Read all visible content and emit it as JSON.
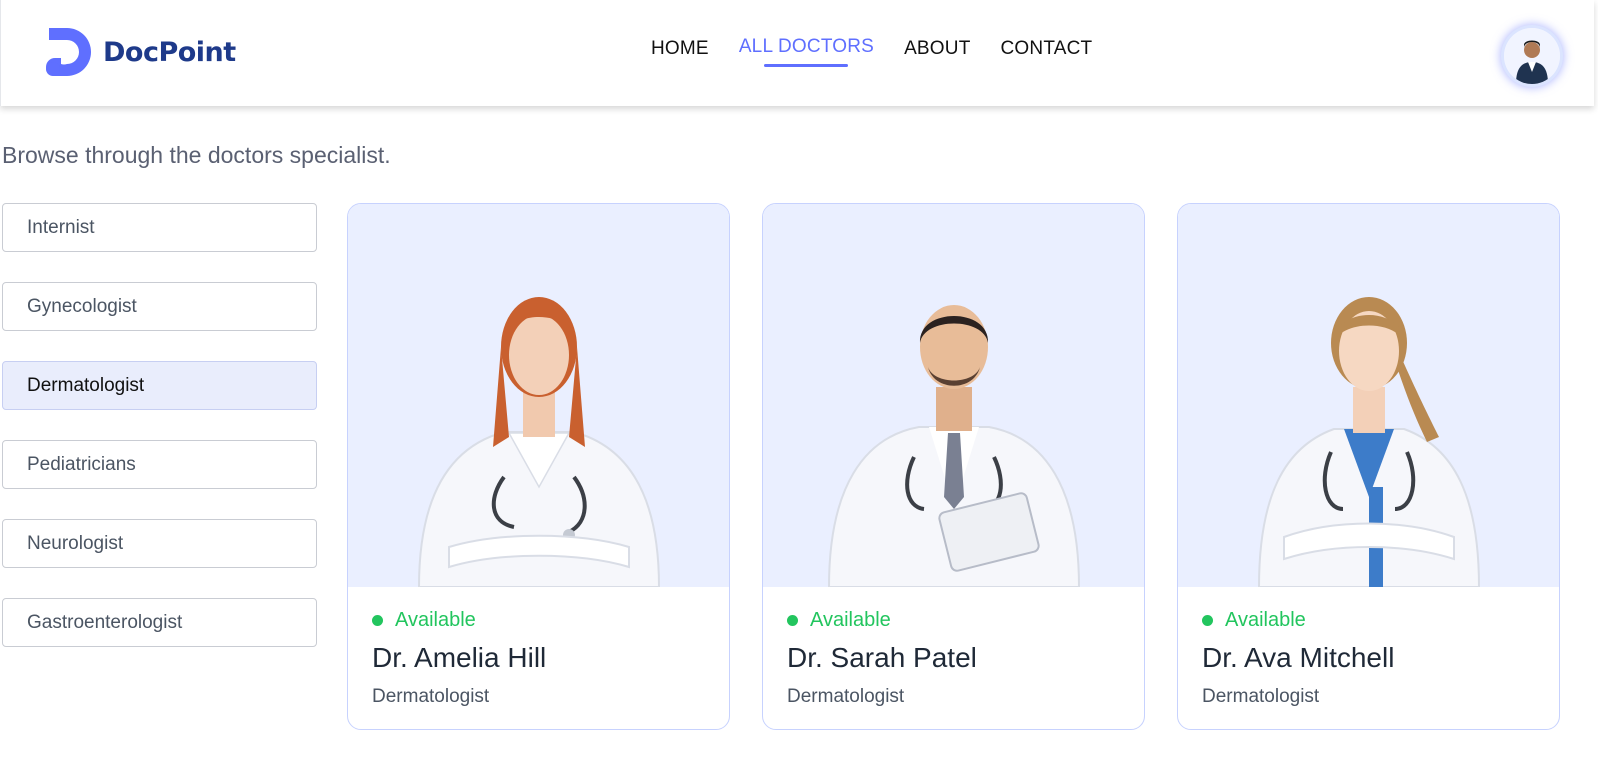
{
  "brand": {
    "name": "DocPoint",
    "color": "#1e3a8a",
    "accent": "#5f6fff"
  },
  "nav": {
    "items": [
      {
        "label": "HOME",
        "active": false
      },
      {
        "label": "ALL DOCTORS",
        "active": true
      },
      {
        "label": "ABOUT",
        "active": false
      },
      {
        "label": "CONTACT",
        "active": false
      }
    ]
  },
  "user": {
    "avatar_icon": "user-avatar-icon"
  },
  "page": {
    "intro": "Browse through the doctors specialist."
  },
  "filters": {
    "items": [
      {
        "label": "Internist",
        "active": false
      },
      {
        "label": "Gynecologist",
        "active": false
      },
      {
        "label": "Dermatologist",
        "active": true
      },
      {
        "label": "Pediatricians",
        "active": false
      },
      {
        "label": "Neurologist",
        "active": false
      },
      {
        "label": "Gastroenterologist",
        "active": false
      }
    ]
  },
  "doctors": [
    {
      "status": "Available",
      "name": "Dr. Amelia Hill",
      "speciality": "Dermatologist",
      "photo": "doctor-photo"
    },
    {
      "status": "Available",
      "name": "Dr. Sarah Patel",
      "speciality": "Dermatologist",
      "photo": "doctor-photo"
    },
    {
      "status": "Available",
      "name": "Dr. Ava Mitchell",
      "speciality": "Dermatologist",
      "photo": "doctor-photo"
    }
  ],
  "colors": {
    "available": "#22c55e",
    "card_bg": "#eaefff",
    "active_filter_bg": "#e9edfc"
  }
}
